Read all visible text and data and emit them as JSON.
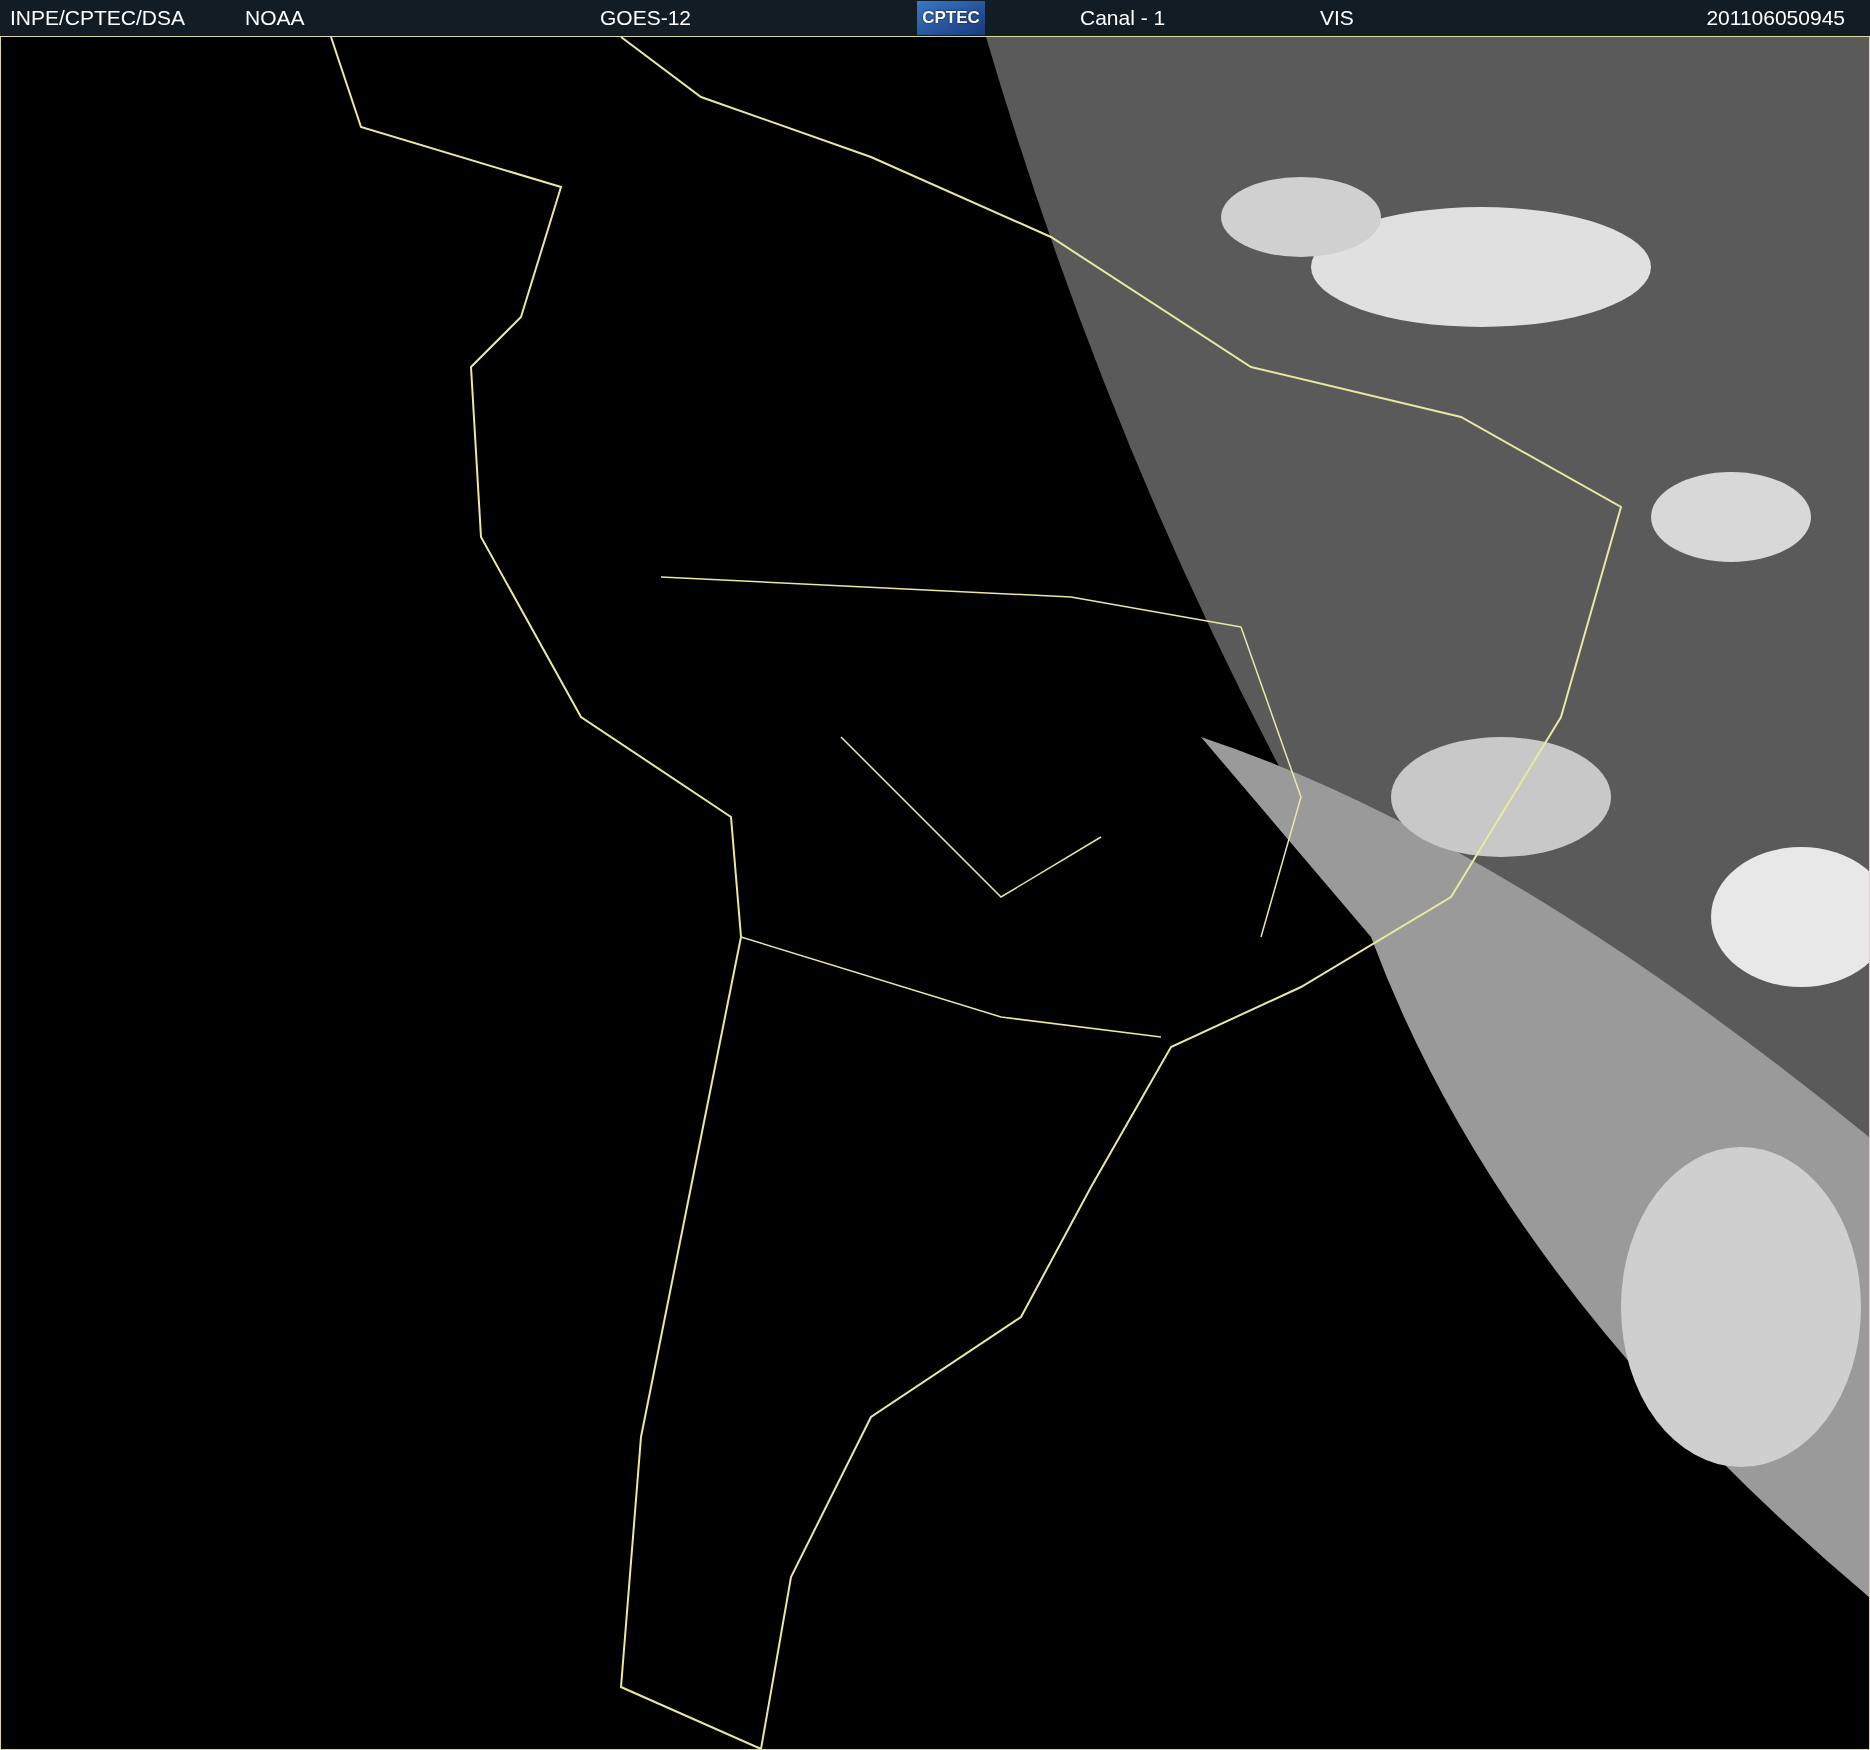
{
  "header": {
    "agency": "INPE/CPTEC/DSA",
    "operator": "NOAA",
    "satellite": "GOES-12",
    "logo_text": "CPTEC",
    "channel": "Canal - 1",
    "band": "VIS",
    "timestamp": "201106050945"
  }
}
